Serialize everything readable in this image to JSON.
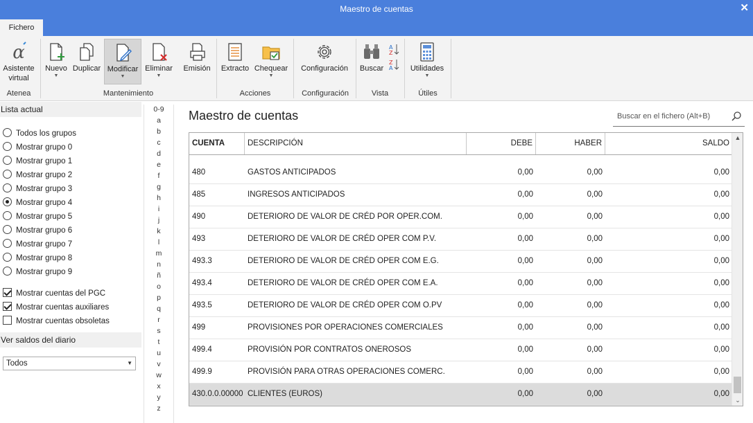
{
  "window": {
    "title": "Maestro de cuentas"
  },
  "ribbon": {
    "tab": "Fichero",
    "buttons": {
      "asistente": "Asistente virtual",
      "asistente_l1": "Asistente",
      "asistente_l2": "virtual",
      "nuevo": "Nuevo",
      "duplicar": "Duplicar",
      "modificar": "Modificar",
      "eliminar": "Eliminar",
      "emision": "Emisión",
      "extracto": "Extracto",
      "chequear": "Chequear",
      "configuracion": "Configuración",
      "buscar": "Buscar",
      "utilidades": "Utilidades"
    },
    "groups": {
      "atenea": "Atenea",
      "mantenimiento": "Mantenimiento",
      "acciones": "Acciones",
      "configuracion": "Configuración",
      "vista": "Vista",
      "utiles": "Útiles"
    }
  },
  "sidebar": {
    "lista_header": "Lista actual",
    "groups": [
      {
        "label": "Todos los grupos",
        "selected": false
      },
      {
        "label": "Mostrar grupo 0",
        "selected": false
      },
      {
        "label": "Mostrar grupo 1",
        "selected": false
      },
      {
        "label": "Mostrar grupo 2",
        "selected": false
      },
      {
        "label": "Mostrar grupo 3",
        "selected": false
      },
      {
        "label": "Mostrar grupo 4",
        "selected": true
      },
      {
        "label": "Mostrar grupo 5",
        "selected": false
      },
      {
        "label": "Mostrar grupo 6",
        "selected": false
      },
      {
        "label": "Mostrar grupo 7",
        "selected": false
      },
      {
        "label": "Mostrar grupo 8",
        "selected": false
      },
      {
        "label": "Mostrar grupo 9",
        "selected": false
      }
    ],
    "checks": [
      {
        "label": "Mostrar cuentas del PGC",
        "checked": true
      },
      {
        "label": "Mostrar cuentas auxiliares",
        "checked": true
      },
      {
        "label": "Mostrar cuentas obsoletas",
        "checked": false
      }
    ],
    "saldos_header": "Ver saldos del diario",
    "saldos_value": "Todos"
  },
  "alphabet": [
    "0-9",
    "a",
    "b",
    "c",
    "d",
    "e",
    "f",
    "g",
    "h",
    "i",
    "j",
    "k",
    "l",
    "m",
    "n",
    "ñ",
    "o",
    "p",
    "q",
    "r",
    "s",
    "t",
    "u",
    "v",
    "w",
    "x",
    "y",
    "z"
  ],
  "main": {
    "title": "Maestro de cuentas",
    "search_placeholder": "Buscar en el fichero (Alt+B)"
  },
  "table": {
    "columns": [
      "CUENTA",
      "DESCRIPCIÓN",
      "DEBE",
      "HABER",
      "SALDO"
    ],
    "rows": [
      [
        "480",
        "GASTOS ANTICIPADOS",
        "0,00",
        "0,00",
        "0,00"
      ],
      [
        "485",
        "INGRESOS ANTICIPADOS",
        "0,00",
        "0,00",
        "0,00"
      ],
      [
        "490",
        "DETERIORO DE VALOR DE CRÉD POR OPER.COM.",
        "0,00",
        "0,00",
        "0,00"
      ],
      [
        "493",
        "DETERIORO DE VALOR DE CRÉD OPER COM P.V.",
        "0,00",
        "0,00",
        "0,00"
      ],
      [
        "493.3",
        "DETERIORO DE VALOR DE CRÉD OPER COM E.G.",
        "0,00",
        "0,00",
        "0,00"
      ],
      [
        "493.4",
        "DETERIORO DE VALOR DE CRÉD OPER COM E.A.",
        "0,00",
        "0,00",
        "0,00"
      ],
      [
        "493.5",
        "DETERIORO DE VALOR DE CRÉD OPER COM O.PV",
        "0,00",
        "0,00",
        "0,00"
      ],
      [
        "499",
        "PROVISIONES POR OPERACIONES COMERCIALES",
        "0,00",
        "0,00",
        "0,00"
      ],
      [
        "499.4",
        "PROVISIÓN POR CONTRATOS ONEROSOS",
        "0,00",
        "0,00",
        "0,00"
      ],
      [
        "499.9",
        "PROVISIÓN PARA OTRAS OPERACIONES COMERC.",
        "0,00",
        "0,00",
        "0,00"
      ],
      [
        "430.0.0.00000",
        "CLIENTES (EUROS)",
        "0,00",
        "0,00",
        "0,00"
      ]
    ],
    "selected_row": 10
  },
  "colors": {
    "accent": "#4a7fdc",
    "selection": "#dcdcdc"
  }
}
